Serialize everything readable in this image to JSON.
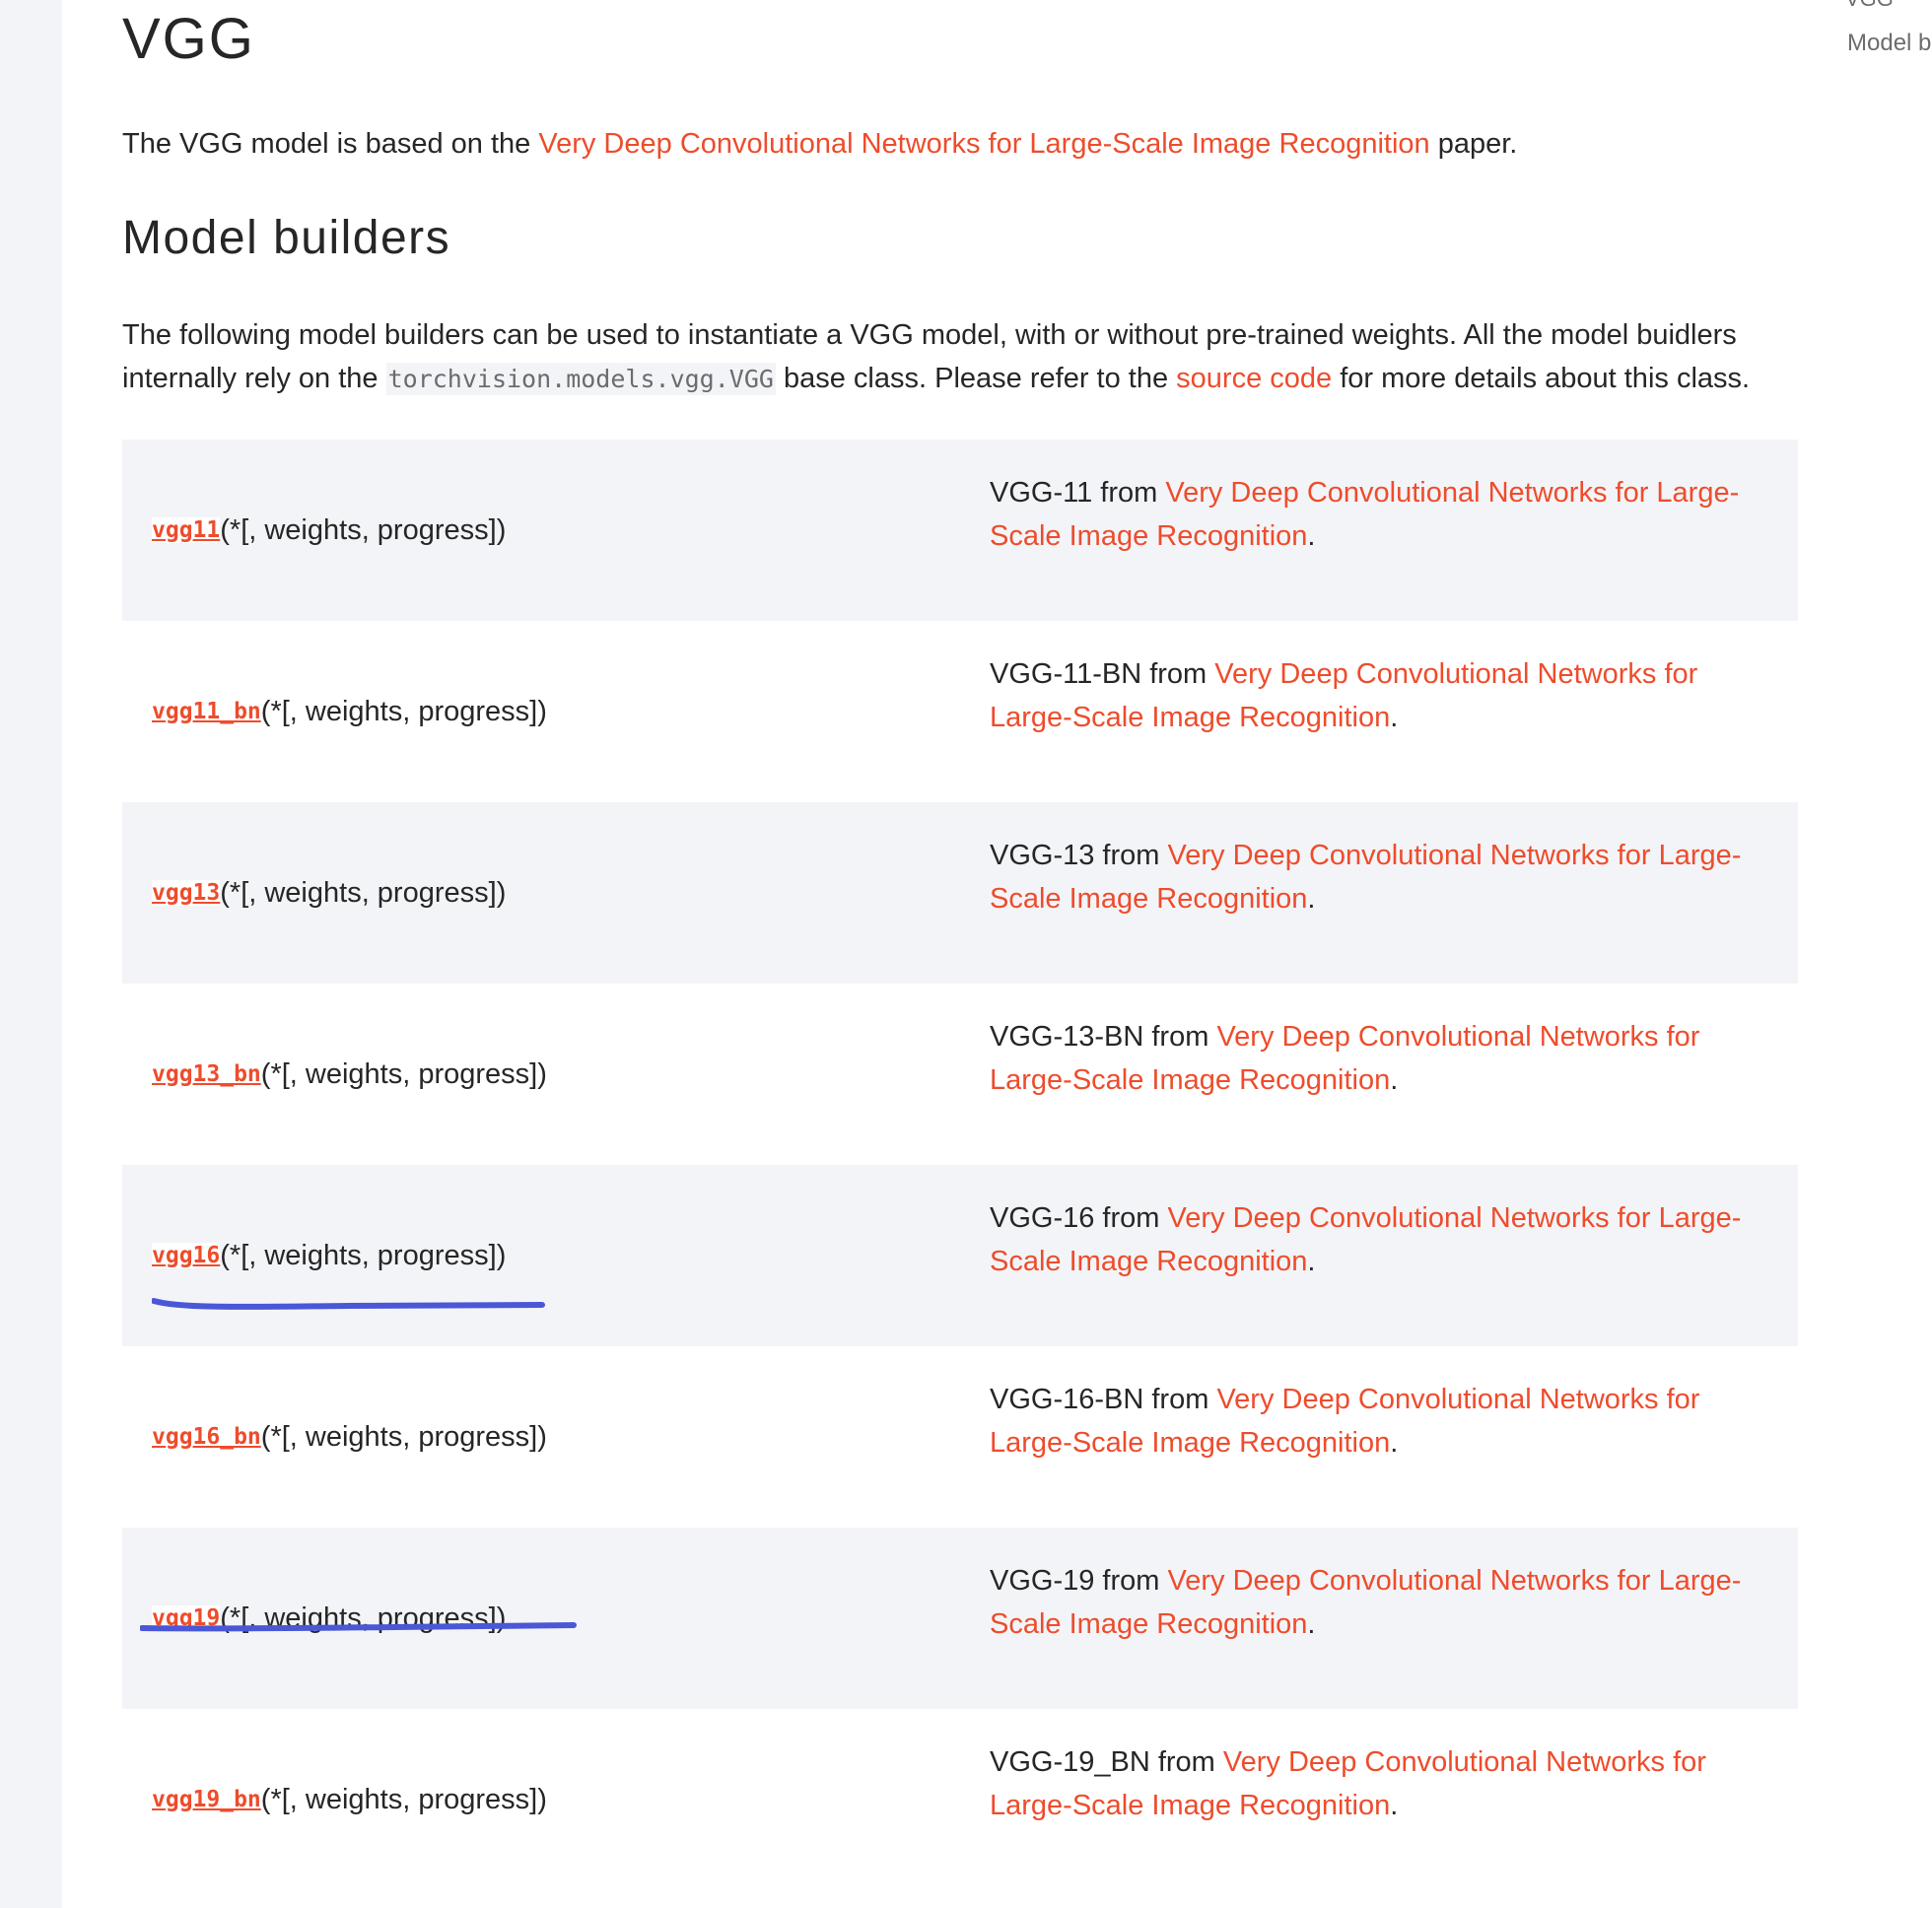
{
  "colors": {
    "link": "#ee4c2c",
    "text": "#262626",
    "shade": "#f3f4f7",
    "annotation": "#4a57d6"
  },
  "toc": {
    "cut_text": "VGG",
    "item": "Model b"
  },
  "page": {
    "title": "VGG",
    "intro_prefix": "The VGG model is based on the ",
    "intro_link": "Very Deep Convolutional Networks for Large-Scale Image Recognition",
    "intro_suffix": " paper."
  },
  "section": {
    "title": "Model builders",
    "desc_1": "The following model builders can be used to instantiate a VGG model, with or without pre-trained weights. All the model buidlers internally rely on the ",
    "desc_code": "torchvision.models.vgg.VGG",
    "desc_2": " base class. Please refer to the ",
    "desc_link": "source code",
    "desc_3": " for more details about this class."
  },
  "builders": [
    {
      "fn": "vgg11",
      "sig": "(*[, weights, progress])",
      "desc_prefix": "VGG-11 from ",
      "desc_link": "Very Deep Convolutional Networks for Large-Scale Image Recognition",
      "desc_suffix": "."
    },
    {
      "fn": "vgg11_bn",
      "sig": "(*[, weights, progress])",
      "desc_prefix": "VGG-11-BN from ",
      "desc_link": "Very Deep Convolutional Networks for Large-Scale Image Recognition",
      "desc_suffix": "."
    },
    {
      "fn": "vgg13",
      "sig": "(*[, weights, progress])",
      "desc_prefix": "VGG-13 from ",
      "desc_link": "Very Deep Convolutional Networks for Large-Scale Image Recognition",
      "desc_suffix": "."
    },
    {
      "fn": "vgg13_bn",
      "sig": "(*[, weights, progress])",
      "desc_prefix": "VGG-13-BN from ",
      "desc_link": "Very Deep Convolutional Networks for Large-Scale Image Recognition",
      "desc_suffix": "."
    },
    {
      "fn": "vgg16",
      "sig": "(*[, weights, progress])",
      "desc_prefix": "VGG-16 from ",
      "desc_link": "Very Deep Convolutional Networks for Large-Scale Image Recognition",
      "desc_suffix": "."
    },
    {
      "fn": "vgg16_bn",
      "sig": "(*[, weights, progress])",
      "desc_prefix": "VGG-16-BN from ",
      "desc_link": "Very Deep Convolutional Networks for Large-Scale Image Recognition",
      "desc_suffix": "."
    },
    {
      "fn": "vgg19",
      "sig": "(*[, weights, progress])",
      "desc_prefix": "VGG-19 from ",
      "desc_link": "Very Deep Convolutional Networks for Large-Scale Image Recognition",
      "desc_suffix": "."
    },
    {
      "fn": "vgg19_bn",
      "sig": "(*[, weights, progress])",
      "desc_prefix": "VGG-19_BN from ",
      "desc_link": "Very Deep Convolutional Networks for Large-Scale Image Recognition",
      "desc_suffix": "."
    }
  ]
}
